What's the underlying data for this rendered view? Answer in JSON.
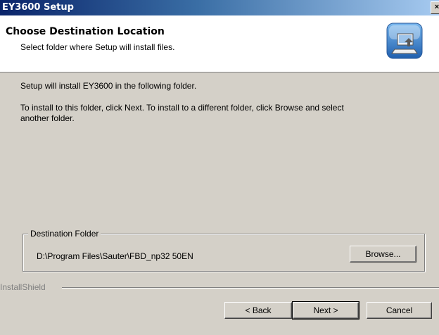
{
  "window": {
    "title": "EY3600 Setup",
    "close_glyph": "×"
  },
  "header": {
    "title": "Choose Destination Location",
    "subtitle": "Select folder where Setup will install files.",
    "icon": "setup-computer-icon"
  },
  "main": {
    "line1": "Setup will install EY3600 in the following folder.",
    "line2a": "To install to this folder, click Next. To install to a different folder, click Browse and select",
    "line2b": "another folder."
  },
  "destination": {
    "legend": "Destination Folder",
    "path": "D:\\Program Files\\Sauter\\FBD_np32 50EN",
    "browse_label": "Browse..."
  },
  "footer": {
    "brand": "InstallShield",
    "back_label": "< Back",
    "next_label": "Next >",
    "cancel_label": "Cancel"
  },
  "colors": {
    "titlebar_start": "#0a246a",
    "titlebar_end": "#a6caf0",
    "face": "#d4d0c8"
  }
}
